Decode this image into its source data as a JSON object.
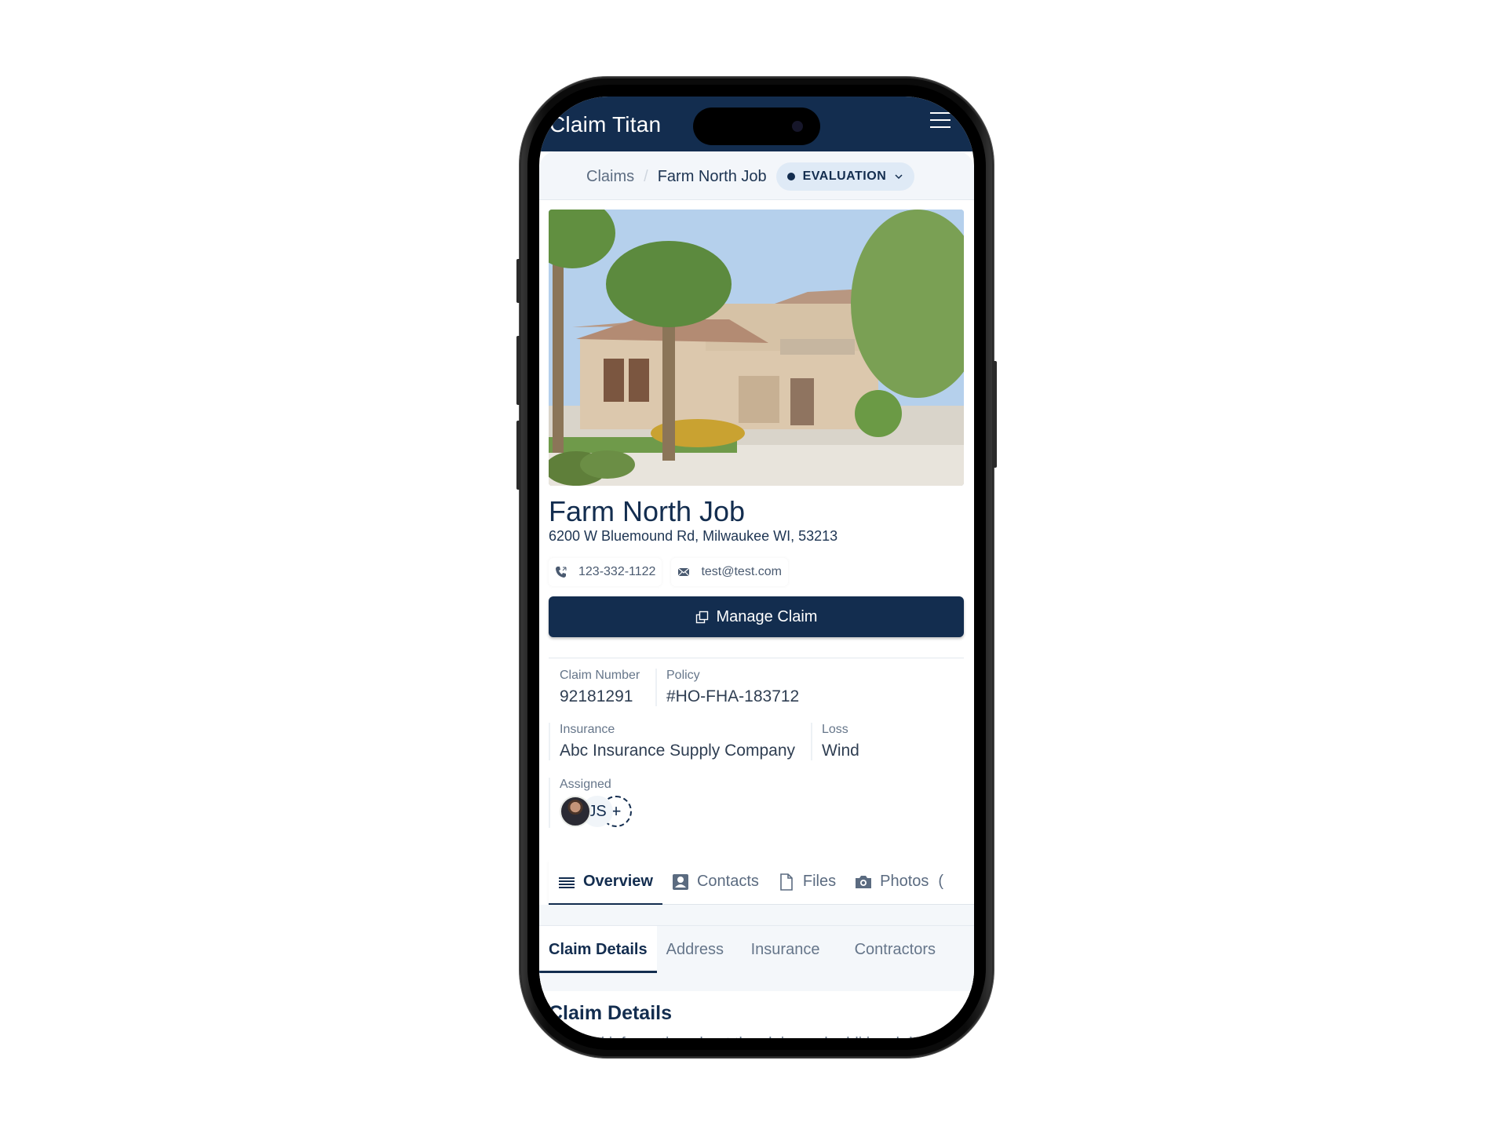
{
  "app": {
    "title": "Claim Titan",
    "menu_icon": "hamburger-menu-icon"
  },
  "breadcrumb": {
    "root": "Claims",
    "separator": "/",
    "current": "Farm North Job",
    "status": "EVALUATION"
  },
  "job": {
    "photo_alt": "Two-story stucco house with palm trees and driveway",
    "title": "Farm North Job",
    "address": "6200 W Bluemound Rd, Milwaukee WI, 53213",
    "phone": "123-332-1122",
    "email": "test@test.com",
    "manage_label": "Manage Claim"
  },
  "fields": {
    "claim_number": {
      "label": "Claim Number",
      "value": "92181291"
    },
    "policy": {
      "label": "Policy",
      "value": "#HO-FHA-183712"
    },
    "insurance": {
      "label": "Insurance",
      "value": "Abc Insurance Supply Company"
    },
    "loss": {
      "label": "Loss",
      "value": "Wind"
    },
    "assigned": {
      "label": "Assigned",
      "initials": "JS",
      "add": "+"
    }
  },
  "main_tabs": [
    {
      "label": "Overview",
      "icon": "list-icon",
      "active": true
    },
    {
      "label": "Contacts",
      "icon": "contact-card-icon",
      "active": false
    },
    {
      "label": "Files",
      "icon": "file-icon",
      "active": false
    },
    {
      "label": "Photos",
      "icon": "camera-icon",
      "active": false
    }
  ],
  "sub_tabs": [
    {
      "label": "Claim Details",
      "active": true
    },
    {
      "label": "Address",
      "active": false
    },
    {
      "label": "Insurance",
      "active": false
    },
    {
      "label": "Contractors",
      "active": false
    }
  ],
  "section": {
    "title": "Claim Details",
    "description": "General information about the claim and additional details"
  },
  "colors": {
    "brand_navy": "#132d4f",
    "muted_text": "#66768a",
    "pill_bg": "#dfeaf6",
    "subtab_bg": "#f4f7fa"
  }
}
